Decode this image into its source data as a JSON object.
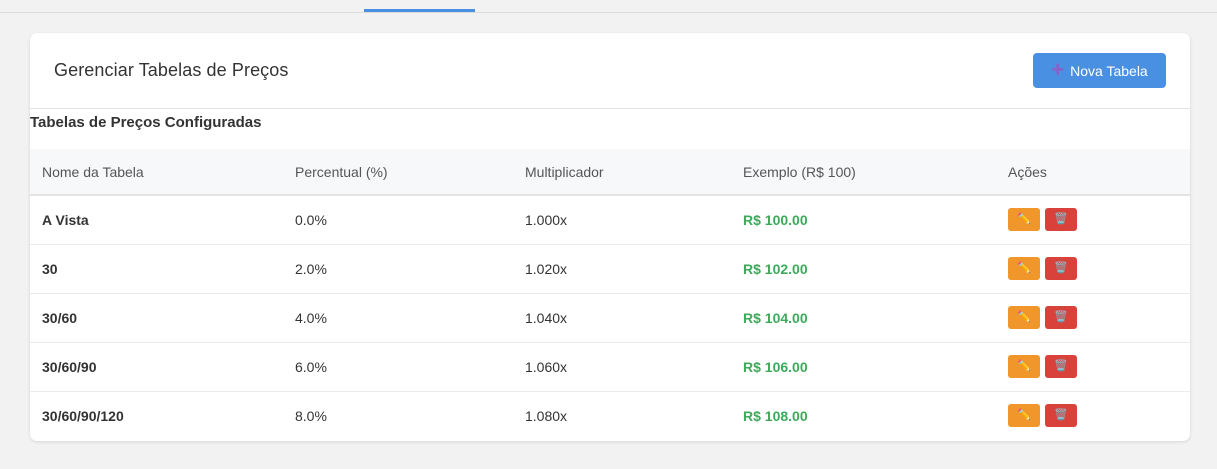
{
  "card": {
    "title": "Gerenciar Tabelas de Preços",
    "new_button_label": "Nova Tabela"
  },
  "section": {
    "title": "Tabelas de Preços Configuradas"
  },
  "table": {
    "headers": [
      "Nome da Tabela",
      "Percentual (%)",
      "Multiplicador",
      "Exemplo (R$ 100)",
      "Ações"
    ],
    "rows": [
      {
        "name": "A Vista",
        "percent": "0.0%",
        "multiplier": "1.000x",
        "example": "R$ 100.00"
      },
      {
        "name": "30",
        "percent": "2.0%",
        "multiplier": "1.020x",
        "example": "R$ 102.00"
      },
      {
        "name": "30/60",
        "percent": "4.0%",
        "multiplier": "1.040x",
        "example": "R$ 104.00"
      },
      {
        "name": "30/60/90",
        "percent": "6.0%",
        "multiplier": "1.060x",
        "example": "R$ 106.00"
      },
      {
        "name": "30/60/90/120",
        "percent": "8.0%",
        "multiplier": "1.080x",
        "example": "R$ 108.00"
      }
    ]
  },
  "icons": {
    "plus": "plus-icon",
    "edit": "pencil-icon",
    "delete": "trash-icon"
  },
  "colors": {
    "primary": "#4a90e2",
    "edit": "#f0962a",
    "delete": "#d9423a",
    "example_value": "#3caa5a"
  }
}
